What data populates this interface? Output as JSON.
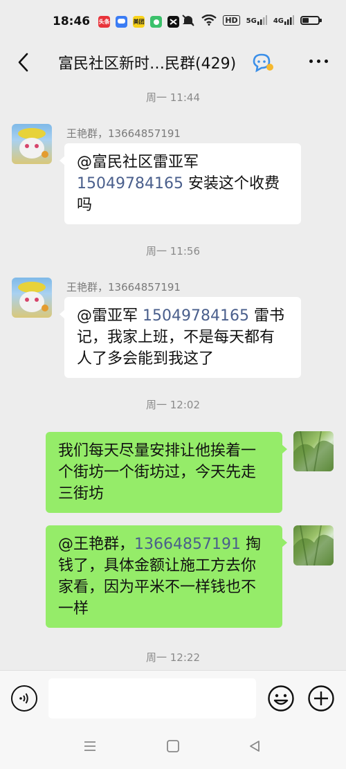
{
  "status_bar": {
    "time": "18:46",
    "app_icons": [
      {
        "name": "toutiao",
        "label": "头条",
        "color": "#e8333a"
      },
      {
        "name": "message",
        "label": "",
        "color": "#3b7cf4"
      },
      {
        "name": "meituan",
        "label": "美团",
        "color": "#f8d21a"
      },
      {
        "name": "android",
        "label": "",
        "color": "#3bc16b"
      },
      {
        "name": "capcut",
        "label": "",
        "color": "#111111"
      }
    ],
    "indicators": [
      "mute",
      "wifi",
      "HD",
      "5G",
      "4G"
    ],
    "hd_label": "HD",
    "net1_label": "5G",
    "net2_label": "4G"
  },
  "header": {
    "back_icon": "chevron-left-icon",
    "title": "富民社区新时…民群(429)",
    "more_icon": "more-icon"
  },
  "messages": [
    {
      "time": "周一 11:44",
      "side": "left",
      "sender": "王艳群，13664857191",
      "parts": [
        {
          "text": "@富民社区雷亚军 ",
          "phone": false
        },
        {
          "text": "15049784165",
          "phone": true
        },
        {
          "text": "  安装这个收费吗",
          "phone": false
        }
      ]
    },
    {
      "time": "周一 11:56",
      "side": "left",
      "sender": "王艳群，13664857191",
      "parts": [
        {
          "text": "@雷亚军 ",
          "phone": false
        },
        {
          "text": "15049784165",
          "phone": true
        },
        {
          "text": "  雷书记，我家上班，不是每天都有人了多会能到我这了",
          "phone": false
        }
      ]
    },
    {
      "time": "周一 12:02",
      "side": "right",
      "sender": "",
      "parts": [
        {
          "text": "我们每天尽量安排让他挨着一个街坊一个街坊过，今天先走三街坊",
          "phone": false
        }
      ]
    },
    {
      "time": "",
      "side": "right",
      "sender": "",
      "parts": [
        {
          "text": "@王艳群，",
          "phone": false
        },
        {
          "text": "13664857191",
          "phone": true
        },
        {
          "text": "  掏钱了，具体金额让施工方去你家看，因为平米不一样钱也不一样",
          "phone": false
        }
      ]
    }
  ],
  "bottom_timestamp": "周一 12:22",
  "input_bar": {
    "placeholder": "",
    "voice_icon": "voice-icon",
    "emoji_icon": "emoji-icon",
    "plus_icon": "plus-icon"
  },
  "nav_bar": {
    "items": [
      "menu-icon",
      "home-icon",
      "back-triangle-icon"
    ]
  },
  "colors": {
    "background": "#ededed",
    "my_bubble": "#95ec69",
    "other_bubble": "#ffffff",
    "phone_link": "#4a5f8c",
    "timestamp": "#8a8a8a"
  }
}
